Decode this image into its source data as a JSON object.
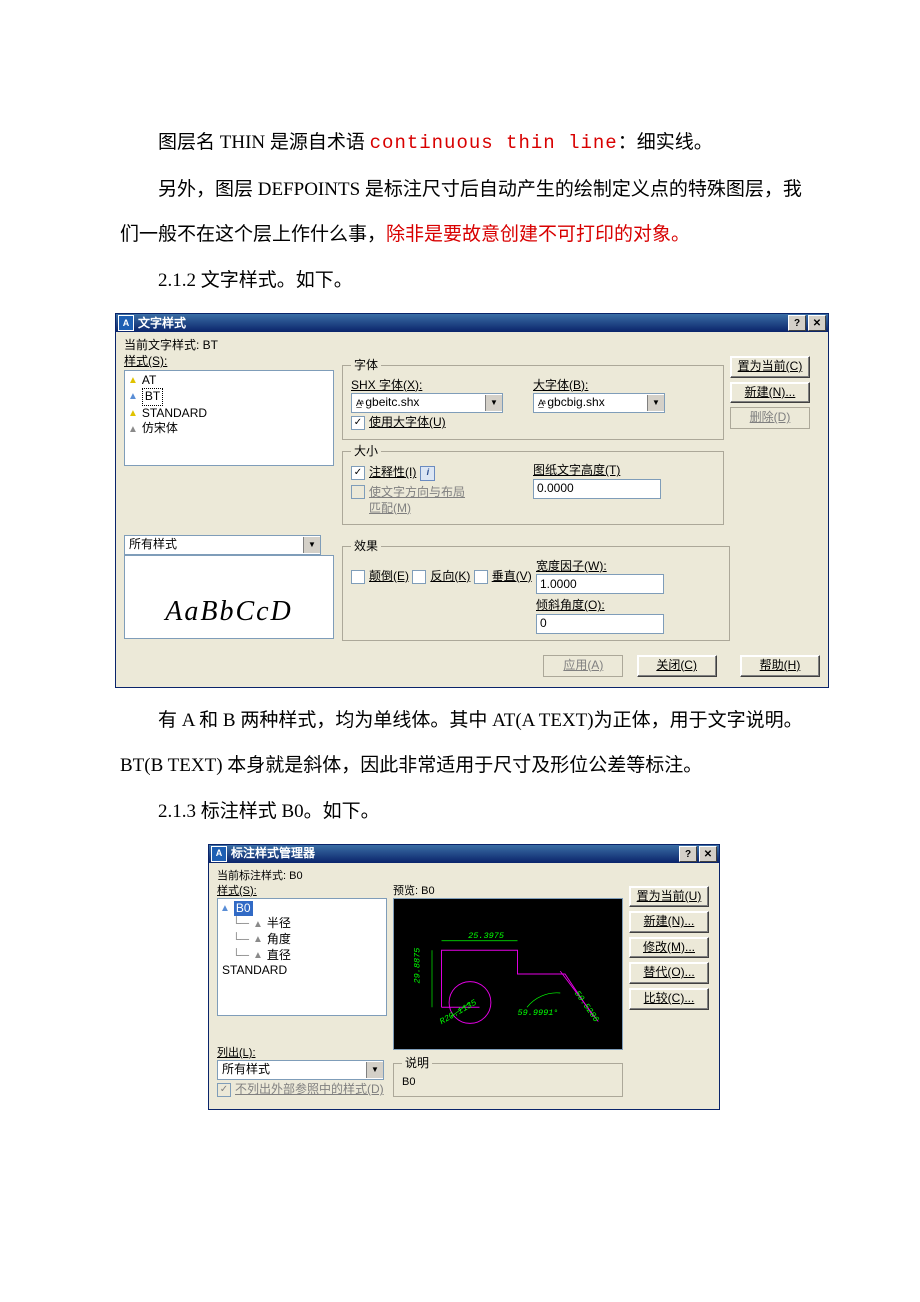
{
  "para1": {
    "a": "图层名 THIN 是源自术语 ",
    "b": "continuous thin line",
    "c": "：细实线。"
  },
  "para2": {
    "a": "另外，图层 DEFPOINTS 是标注尺寸后自动产生的绘制定义点的特殊图层，我们一般不在这个层上作什么事，",
    "b": "除非是要故意创建不可打印的对象。"
  },
  "para3": "2.1.2 文字样式。如下。",
  "dlg1": {
    "title": "文字样式",
    "help": "?",
    "close": "✕",
    "cur": "当前文字样式:  BT",
    "styles_label": "样式(S):",
    "styles": [
      "AT",
      "BT",
      "STANDARD",
      "仿宋体"
    ],
    "filter": "所有样式",
    "preview": "AaBbCcD",
    "font": {
      "legend": "字体",
      "shx_label": "SHX 字体(X):",
      "shx_val": "gbeitc.shx",
      "big_label": "大字体(B):",
      "big_val": "gbcbig.shx",
      "use_big": "使用大字体(U)"
    },
    "size": {
      "legend": "大小",
      "anno": "注释性(I)",
      "match": "使文字方向与布局\n匹配(M)",
      "height_label": "图纸文字高度(T)",
      "height": "0.0000"
    },
    "fx": {
      "legend": "效果",
      "upside": "颠倒(E)",
      "back": "反向(K)",
      "vert": "垂直(V)",
      "width_label": "宽度因子(W):",
      "width": "1.0000",
      "obl_label": "倾斜角度(O):",
      "obl": "0"
    },
    "btn": {
      "setcur": "置为当前(C)",
      "new": "新建(N)...",
      "del": "删除(D)",
      "apply": "应用(A)",
      "close2": "关闭(C)",
      "help2": "帮助(H)"
    }
  },
  "para4": "有 A 和 B 两种样式，均为单线体。其中 AT(A TEXT)为正体，用于文字说明。BT(B TEXT) 本身就是斜体，因此非常适用于尺寸及形位公差等标注。",
  "para5": "2.1.3 标注样式 B0。如下。",
  "dlg2": {
    "title": "标注样式管理器",
    "help": "?",
    "close": "✕",
    "cur": "当前标注样式: B0",
    "styles_label": "样式(S):",
    "items": [
      "B0",
      "半径",
      "角度",
      "直径",
      "STANDARD"
    ],
    "preview_label": "预览: B0",
    "list_label": "列出(L):",
    "list_val": "所有样式",
    "noext": "不列出外部参照中的样式(D)",
    "desc_legend": "说明",
    "desc": "B0",
    "btn": {
      "setcur": "置为当前(U)",
      "new": "新建(N)...",
      "mod": "修改(M)...",
      "over": "替代(O)...",
      "cmp": "比较(C)..."
    },
    "dims": {
      "top": "25.3975",
      "left": "29.8875",
      "arc": "R20.1135",
      "ang": "59.9991°",
      "diag": "50.5286"
    }
  }
}
